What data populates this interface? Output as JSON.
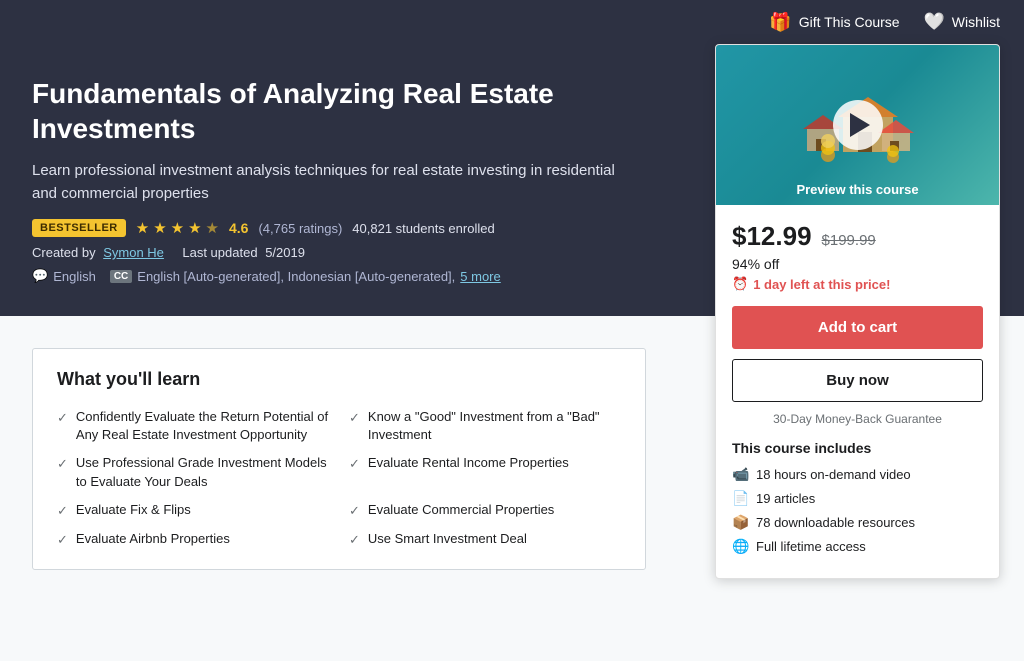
{
  "header": {
    "gift_label": "Gift This Course",
    "wishlist_label": "Wishlist"
  },
  "hero": {
    "title": "Fundamentals of Analyzing Real Estate Investments",
    "subtitle": "Learn professional investment analysis techniques for real estate investing in residential and commercial properties",
    "badge": "BESTSELLER",
    "rating_value": "4.6",
    "rating_count": "(4,765 ratings)",
    "students_count": "40,821 students enrolled",
    "created_by_label": "Created by",
    "author": "Symon He",
    "updated_label": "Last updated",
    "updated_date": "5/2019",
    "language": "English",
    "captions": "English [Auto-generated], Indonesian [Auto-generated],",
    "more_link": "5 more"
  },
  "sidebar": {
    "preview_label": "Preview this course",
    "price_current": "$12.99",
    "price_original": "$199.99",
    "discount": "94% off",
    "urgency": "1 day left at this price!",
    "add_cart_label": "Add to cart",
    "buy_now_label": "Buy now",
    "guarantee": "30-Day Money-Back Guarantee",
    "includes_title": "This course includes",
    "includes": [
      {
        "icon": "📹",
        "text": "18 hours on-demand video"
      },
      {
        "icon": "📄",
        "text": "19 articles"
      },
      {
        "icon": "📦",
        "text": "78 downloadable resources"
      },
      {
        "icon": "🌐",
        "text": "Full lifetime access"
      }
    ]
  },
  "learn": {
    "title": "What you'll learn",
    "items": [
      {
        "text": "Confidently Evaluate the Return Potential of Any Real Estate Investment Opportunity"
      },
      {
        "text": "Know a \"Good\" Investment from a \"Bad\" Investment"
      },
      {
        "text": "Use Professional Grade Investment Models to Evaluate Your Deals"
      },
      {
        "text": "Evaluate Rental Income Properties"
      },
      {
        "text": "Evaluate Fix & Flips"
      },
      {
        "text": "Evaluate Commercial Properties"
      },
      {
        "text": "Evaluate Airbnb Properties"
      },
      {
        "text": "Use Smart Investment Deal"
      }
    ]
  }
}
